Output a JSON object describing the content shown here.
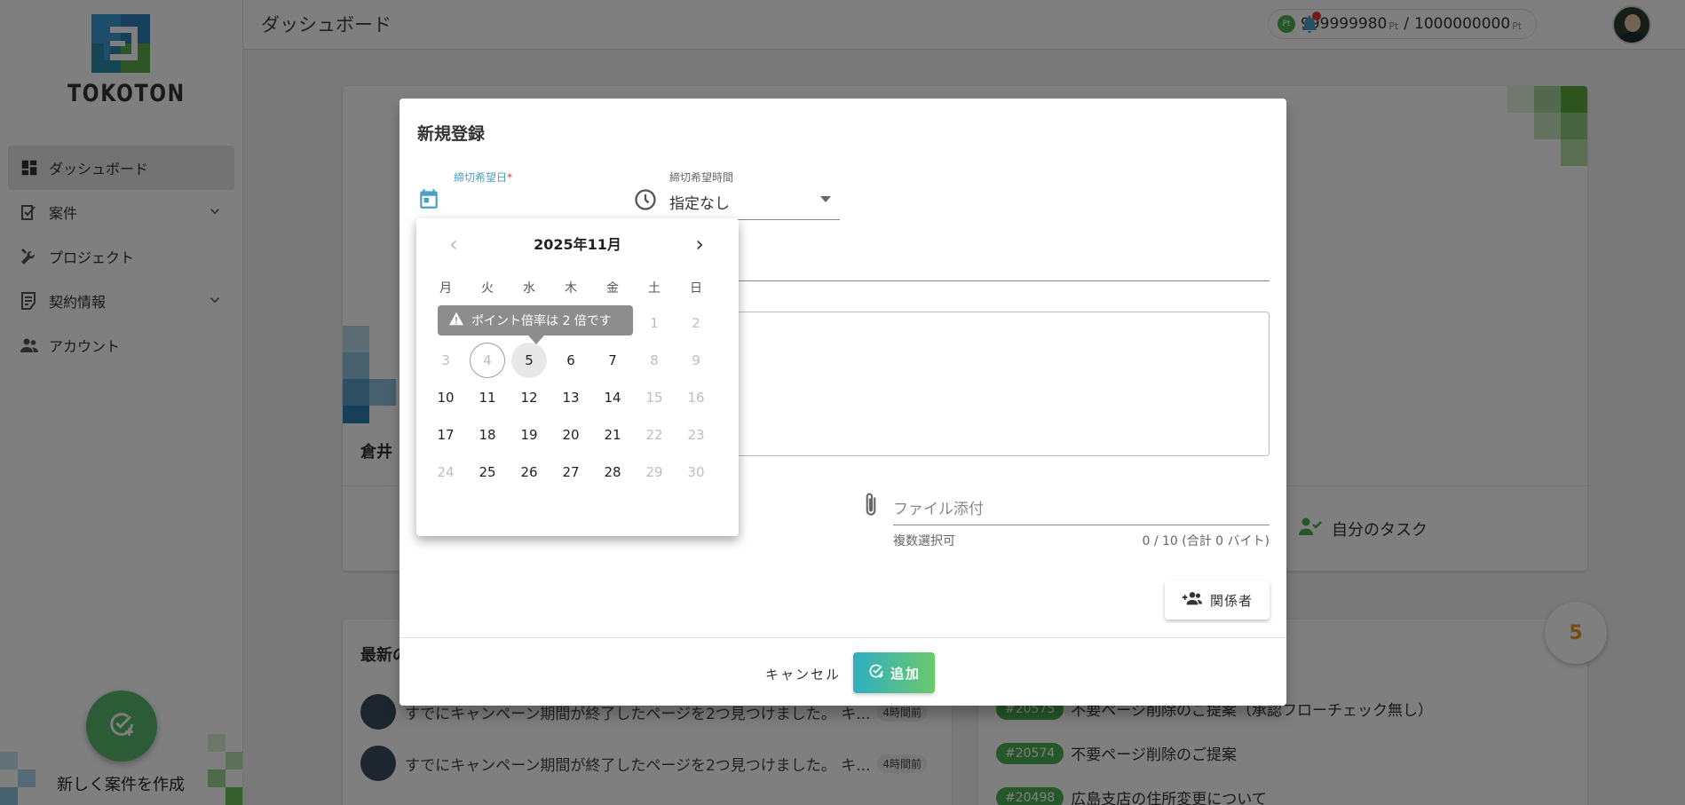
{
  "app": {
    "logo_text": "TOKOTON",
    "page_title": "ダッシュボード",
    "points": {
      "badge": "Pt",
      "current": "999999980",
      "unit": "Pt",
      "separator": "/",
      "total": "1000000000"
    },
    "colors": {
      "brand_green": "#4caf50",
      "accent_blue": "#4a9fc4",
      "notification_red": "#e53935"
    }
  },
  "sidebar": {
    "items": [
      {
        "label": "ダッシュボード",
        "icon": "dashboard-icon",
        "active": true
      },
      {
        "label": "案件",
        "icon": "checklist-icon",
        "expandable": true
      },
      {
        "label": "プロジェクト",
        "icon": "tools-icon"
      },
      {
        "label": "契約情報",
        "icon": "contract-icon",
        "expandable": true
      },
      {
        "label": "アカウント",
        "icon": "people-icon"
      }
    ],
    "create_label": "新しく案件を作成"
  },
  "dashboard": {
    "card_name": "倉井",
    "my_task_label": "自分のタスク",
    "latest_title": "最新の",
    "feed": [
      {
        "text": "すでにキャンペーン期間が終了したページを2つ見つけました。 キ...",
        "time": "4時間前"
      },
      {
        "text": "すでにキャンペーン期間が終了したページを2つ見つけました。 キ...",
        "time": "4時間前"
      }
    ],
    "tickets": [
      {
        "id": "#20575",
        "title": "不要ページ削除のご提案（承認フローチェック無し）"
      },
      {
        "id": "#20574",
        "title": "不要ページ削除のご提案"
      },
      {
        "id": "#20498",
        "title": "広島支店の住所変更について"
      }
    ],
    "badge_count": "5"
  },
  "dialog": {
    "title": "新規登録",
    "deadline_date": {
      "label": "締切希望日",
      "required_mark": "*"
    },
    "deadline_time": {
      "label": "締切希望時間",
      "value": "指定なし"
    },
    "attach": {
      "placeholder": "ファイル添付",
      "hint": "複数選択可",
      "count": "0 / 10 (合計 0 バイト)"
    },
    "related_label": "関係者",
    "cancel_label": "キャンセル",
    "add_label": "追加"
  },
  "datepicker": {
    "month": "2025年11月",
    "weekdays": [
      "月",
      "火",
      "水",
      "木",
      "金",
      "土",
      "日"
    ],
    "tooltip": "ポイント倍率は 2 倍です",
    "weeks": [
      [
        {
          "d": ""
        },
        {
          "d": ""
        },
        {
          "d": ""
        },
        {
          "d": ""
        },
        {
          "d": ""
        },
        {
          "d": "1",
          "s": "disabled"
        },
        {
          "d": "2",
          "s": "disabled"
        }
      ],
      [
        {
          "d": "3",
          "s": "disabled"
        },
        {
          "d": "4",
          "s": "today"
        },
        {
          "d": "5",
          "s": "hover"
        },
        {
          "d": "6"
        },
        {
          "d": "7"
        },
        {
          "d": "8",
          "s": "disabled"
        },
        {
          "d": "9",
          "s": "disabled"
        }
      ],
      [
        {
          "d": "10"
        },
        {
          "d": "11"
        },
        {
          "d": "12"
        },
        {
          "d": "13"
        },
        {
          "d": "14"
        },
        {
          "d": "15",
          "s": "disabled"
        },
        {
          "d": "16",
          "s": "disabled"
        }
      ],
      [
        {
          "d": "17"
        },
        {
          "d": "18"
        },
        {
          "d": "19"
        },
        {
          "d": "20"
        },
        {
          "d": "21"
        },
        {
          "d": "22",
          "s": "disabled"
        },
        {
          "d": "23",
          "s": "disabled"
        }
      ],
      [
        {
          "d": "24",
          "s": "disabled"
        },
        {
          "d": "25"
        },
        {
          "d": "26"
        },
        {
          "d": "27"
        },
        {
          "d": "28"
        },
        {
          "d": "29",
          "s": "disabled"
        },
        {
          "d": "30",
          "s": "disabled"
        }
      ]
    ]
  }
}
